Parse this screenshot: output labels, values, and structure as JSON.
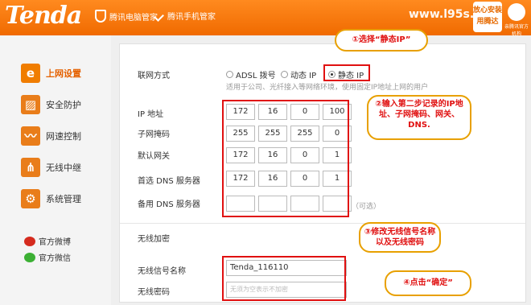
{
  "header": {
    "logo": "Tenda",
    "badge1": "腾讯电脑管家",
    "badge2": "腾讯手机管家",
    "watermark": "www.l95s.com",
    "right_logo_line1": "放心安装",
    "right_logo_line2": "用腾达",
    "right_logo_caption": "亲腾讯官方机构"
  },
  "sidebar": {
    "items": [
      {
        "label": "上网设置",
        "icon": "e-icon",
        "active": true
      },
      {
        "label": "安全防护",
        "icon": "shield-icon",
        "active": false
      },
      {
        "label": "网速控制",
        "icon": "speed-icon",
        "active": false
      },
      {
        "label": "无线中继",
        "icon": "wireless-icon",
        "active": false
      },
      {
        "label": "系统管理",
        "icon": "gear-icon",
        "active": false
      }
    ],
    "social": [
      {
        "label": "官方微博",
        "icon": "weibo-icon"
      },
      {
        "label": "官方微信",
        "icon": "wechat-icon"
      }
    ]
  },
  "form": {
    "connection_label": "联网方式",
    "options": [
      "ADSL 拨号",
      "动态 IP",
      "静态 IP"
    ],
    "selected_option": "静态 IP",
    "hint": "适用于公司、光纤接入等网络环境，使用固定IP地址上网的用户",
    "fields": [
      {
        "label": "IP 地址",
        "values": [
          "172",
          "16",
          "0",
          "100"
        ]
      },
      {
        "label": "子网掩码",
        "values": [
          "255",
          "255",
          "255",
          "0"
        ]
      },
      {
        "label": "默认网关",
        "values": [
          "172",
          "16",
          "0",
          "1"
        ]
      },
      {
        "label": "首选 DNS 服务器",
        "values": [
          "172",
          "16",
          "0",
          "1"
        ]
      },
      {
        "label": "备用 DNS 服务器",
        "values": [
          "",
          "",
          "",
          ""
        ]
      }
    ],
    "optional_note": "（可选）",
    "wireless_section_title": "无线加密",
    "ssid_label": "无线信号名称",
    "ssid_value": "Tenda_116110",
    "password_label": "无线密码",
    "password_placeholder": "无须为空表示不加密"
  },
  "annotations": {
    "step1": "①选择“静态IP”",
    "step2": "②输入第二步记录的IP地址、子网掩码、网关、DNS.",
    "step3": "③修改无线信号名称以及无线密码",
    "step4": "④点击“确定”"
  },
  "colors": {
    "brand_orange": "#f07d00",
    "annotation_red": "#e01010",
    "callout_border": "#e8a000"
  }
}
